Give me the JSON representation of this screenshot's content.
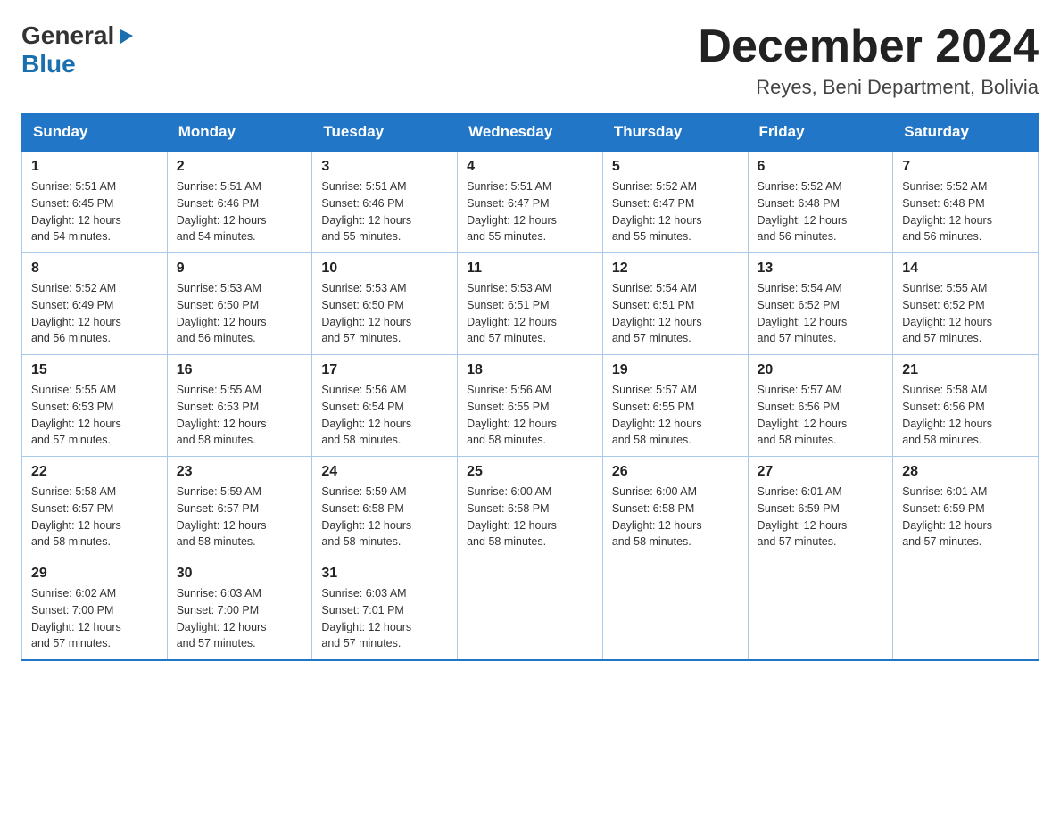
{
  "logo": {
    "text_general": "General",
    "text_blue": "Blue",
    "arrow": "▶"
  },
  "title": "December 2024",
  "location": "Reyes, Beni Department, Bolivia",
  "days_of_week": [
    "Sunday",
    "Monday",
    "Tuesday",
    "Wednesday",
    "Thursday",
    "Friday",
    "Saturday"
  ],
  "weeks": [
    [
      {
        "date": "1",
        "sunrise": "5:51 AM",
        "sunset": "6:45 PM",
        "daylight": "12 hours and 54 minutes."
      },
      {
        "date": "2",
        "sunrise": "5:51 AM",
        "sunset": "6:46 PM",
        "daylight": "12 hours and 54 minutes."
      },
      {
        "date": "3",
        "sunrise": "5:51 AM",
        "sunset": "6:46 PM",
        "daylight": "12 hours and 55 minutes."
      },
      {
        "date": "4",
        "sunrise": "5:51 AM",
        "sunset": "6:47 PM",
        "daylight": "12 hours and 55 minutes."
      },
      {
        "date": "5",
        "sunrise": "5:52 AM",
        "sunset": "6:47 PM",
        "daylight": "12 hours and 55 minutes."
      },
      {
        "date": "6",
        "sunrise": "5:52 AM",
        "sunset": "6:48 PM",
        "daylight": "12 hours and 56 minutes."
      },
      {
        "date": "7",
        "sunrise": "5:52 AM",
        "sunset": "6:48 PM",
        "daylight": "12 hours and 56 minutes."
      }
    ],
    [
      {
        "date": "8",
        "sunrise": "5:52 AM",
        "sunset": "6:49 PM",
        "daylight": "12 hours and 56 minutes."
      },
      {
        "date": "9",
        "sunrise": "5:53 AM",
        "sunset": "6:50 PM",
        "daylight": "12 hours and 56 minutes."
      },
      {
        "date": "10",
        "sunrise": "5:53 AM",
        "sunset": "6:50 PM",
        "daylight": "12 hours and 57 minutes."
      },
      {
        "date": "11",
        "sunrise": "5:53 AM",
        "sunset": "6:51 PM",
        "daylight": "12 hours and 57 minutes."
      },
      {
        "date": "12",
        "sunrise": "5:54 AM",
        "sunset": "6:51 PM",
        "daylight": "12 hours and 57 minutes."
      },
      {
        "date": "13",
        "sunrise": "5:54 AM",
        "sunset": "6:52 PM",
        "daylight": "12 hours and 57 minutes."
      },
      {
        "date": "14",
        "sunrise": "5:55 AM",
        "sunset": "6:52 PM",
        "daylight": "12 hours and 57 minutes."
      }
    ],
    [
      {
        "date": "15",
        "sunrise": "5:55 AM",
        "sunset": "6:53 PM",
        "daylight": "12 hours and 57 minutes."
      },
      {
        "date": "16",
        "sunrise": "5:55 AM",
        "sunset": "6:53 PM",
        "daylight": "12 hours and 58 minutes."
      },
      {
        "date": "17",
        "sunrise": "5:56 AM",
        "sunset": "6:54 PM",
        "daylight": "12 hours and 58 minutes."
      },
      {
        "date": "18",
        "sunrise": "5:56 AM",
        "sunset": "6:55 PM",
        "daylight": "12 hours and 58 minutes."
      },
      {
        "date": "19",
        "sunrise": "5:57 AM",
        "sunset": "6:55 PM",
        "daylight": "12 hours and 58 minutes."
      },
      {
        "date": "20",
        "sunrise": "5:57 AM",
        "sunset": "6:56 PM",
        "daylight": "12 hours and 58 minutes."
      },
      {
        "date": "21",
        "sunrise": "5:58 AM",
        "sunset": "6:56 PM",
        "daylight": "12 hours and 58 minutes."
      }
    ],
    [
      {
        "date": "22",
        "sunrise": "5:58 AM",
        "sunset": "6:57 PM",
        "daylight": "12 hours and 58 minutes."
      },
      {
        "date": "23",
        "sunrise": "5:59 AM",
        "sunset": "6:57 PM",
        "daylight": "12 hours and 58 minutes."
      },
      {
        "date": "24",
        "sunrise": "5:59 AM",
        "sunset": "6:58 PM",
        "daylight": "12 hours and 58 minutes."
      },
      {
        "date": "25",
        "sunrise": "6:00 AM",
        "sunset": "6:58 PM",
        "daylight": "12 hours and 58 minutes."
      },
      {
        "date": "26",
        "sunrise": "6:00 AM",
        "sunset": "6:58 PM",
        "daylight": "12 hours and 58 minutes."
      },
      {
        "date": "27",
        "sunrise": "6:01 AM",
        "sunset": "6:59 PM",
        "daylight": "12 hours and 57 minutes."
      },
      {
        "date": "28",
        "sunrise": "6:01 AM",
        "sunset": "6:59 PM",
        "daylight": "12 hours and 57 minutes."
      }
    ],
    [
      {
        "date": "29",
        "sunrise": "6:02 AM",
        "sunset": "7:00 PM",
        "daylight": "12 hours and 57 minutes."
      },
      {
        "date": "30",
        "sunrise": "6:03 AM",
        "sunset": "7:00 PM",
        "daylight": "12 hours and 57 minutes."
      },
      {
        "date": "31",
        "sunrise": "6:03 AM",
        "sunset": "7:01 PM",
        "daylight": "12 hours and 57 minutes."
      },
      null,
      null,
      null,
      null
    ]
  ],
  "labels": {
    "sunrise": "Sunrise:",
    "sunset": "Sunset:",
    "daylight": "Daylight:"
  }
}
